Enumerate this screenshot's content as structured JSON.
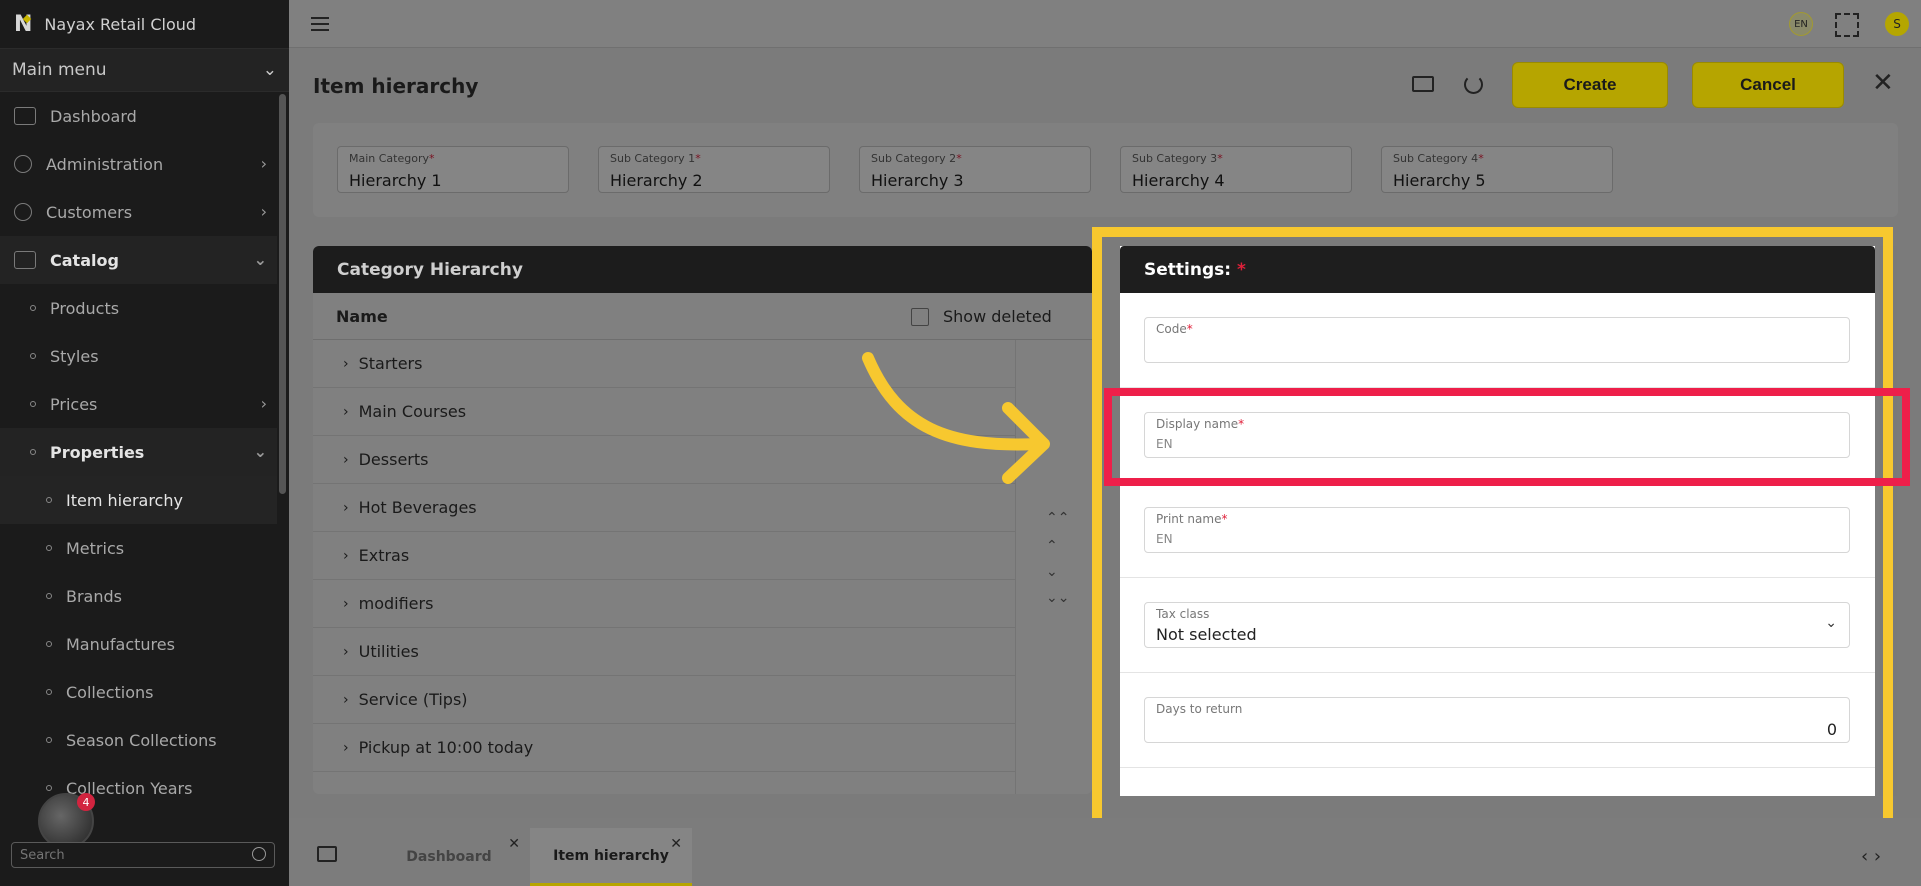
{
  "app": {
    "name": "Nayax Retail Cloud"
  },
  "sidebar": {
    "menu_title": "Main menu",
    "items": [
      {
        "label": "Dashboard"
      },
      {
        "label": "Administration"
      },
      {
        "label": "Customers"
      },
      {
        "label": "Catalog"
      },
      {
        "label": "Products"
      },
      {
        "label": "Styles"
      },
      {
        "label": "Prices"
      },
      {
        "label": "Properties"
      },
      {
        "label": "Item hierarchy"
      },
      {
        "label": "Metrics"
      },
      {
        "label": "Brands"
      },
      {
        "label": "Manufactures"
      },
      {
        "label": "Collections"
      },
      {
        "label": "Season Collections"
      },
      {
        "label": "Collection Years"
      }
    ],
    "notification_count": "4",
    "search_placeholder": "Search"
  },
  "topbar": {
    "lang": "EN",
    "user_initial": "S"
  },
  "page": {
    "title": "Item hierarchy",
    "create_label": "Create",
    "cancel_label": "Cancel"
  },
  "hierarchy_fields": [
    {
      "label": "Main Category",
      "value": "Hierarchy 1"
    },
    {
      "label": "Sub Category 1",
      "value": "Hierarchy 2"
    },
    {
      "label": "Sub Category 2",
      "value": "Hierarchy 3"
    },
    {
      "label": "Sub Category 3",
      "value": "Hierarchy 4"
    },
    {
      "label": "Sub Category 4",
      "value": "Hierarchy 5"
    }
  ],
  "category_panel": {
    "title": "Category Hierarchy",
    "name_col": "Name",
    "show_deleted": "Show deleted",
    "rows": [
      "Starters",
      "Main Courses",
      "Desserts",
      "Hot Beverages",
      "Extras",
      "modifiers",
      "Utilities",
      "Service (Tips)",
      "Pickup at 10:00 today"
    ]
  },
  "settings": {
    "title": "Settings:",
    "code_label": "Code",
    "display_name_label": "Display name",
    "display_name_lang": "EN",
    "print_name_label": "Print name",
    "print_name_lang": "EN",
    "tax_class_label": "Tax class",
    "tax_class_value": "Not selected",
    "days_label": "Days to return",
    "days_value": "0"
  },
  "bottom_tabs": [
    {
      "label": "Dashboard"
    },
    {
      "label": "Item hierarchy"
    }
  ],
  "colors": {
    "accent": "#b6a500",
    "annotation_yellow": "#f7c82f",
    "annotation_red": "#ee1f4a"
  }
}
